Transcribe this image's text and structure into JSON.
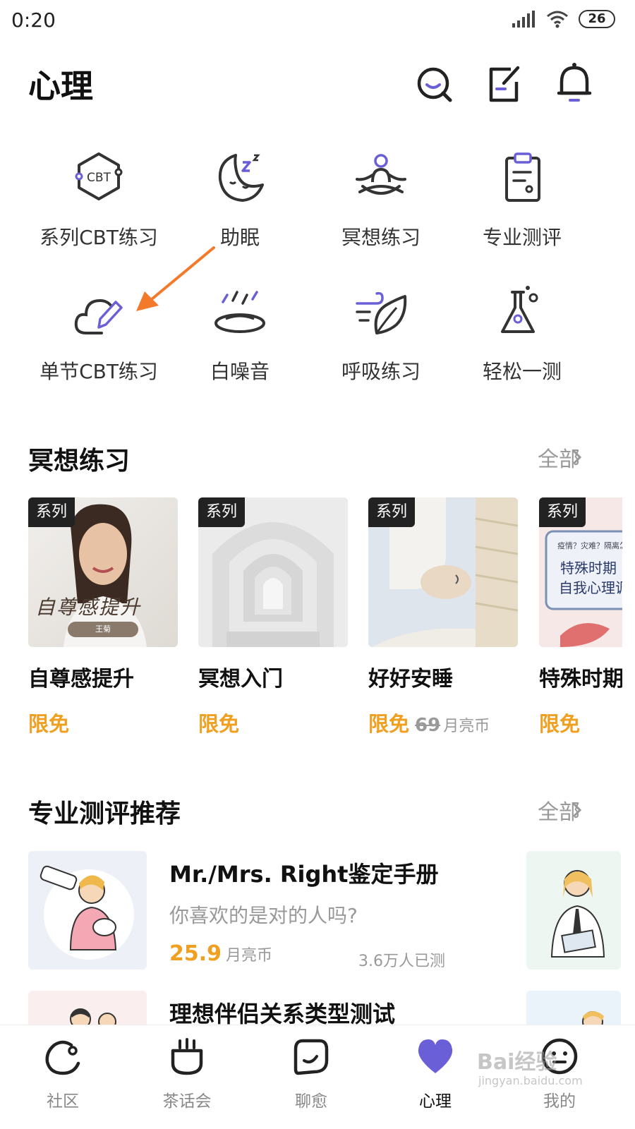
{
  "status_bar": {
    "time": "0:20",
    "battery": "26"
  },
  "header": {
    "title": "心理"
  },
  "feature_grid": [
    {
      "label": "系列CBT练习",
      "icon": "cbt-hexagon-icon"
    },
    {
      "label": "助眠",
      "icon": "moon-sleep-icon"
    },
    {
      "label": "冥想练习",
      "icon": "meditation-icon"
    },
    {
      "label": "专业测评",
      "icon": "clipboard-icon"
    },
    {
      "label": "单节CBT练习",
      "icon": "cloud-pen-icon"
    },
    {
      "label": "白噪音",
      "icon": "rain-icon"
    },
    {
      "label": "呼吸练习",
      "icon": "wind-leaf-icon"
    },
    {
      "label": "轻松一测",
      "icon": "flask-icon"
    }
  ],
  "meditation": {
    "title": "冥想练习",
    "all_label": "全部",
    "cards": [
      {
        "tag": "系列",
        "title": "自尊感提升",
        "price": "限免",
        "thumb_text": "自尊感提升",
        "thumb_sub": "王菊"
      },
      {
        "tag": "系列",
        "title": "冥想入门",
        "price": "限免"
      },
      {
        "tag": "系列",
        "title": "好好安睡",
        "price": "限免",
        "original_price": "69",
        "unit": "月亮币"
      },
      {
        "tag": "系列",
        "title": "特殊时期",
        "price": "限免",
        "thumb_small": "疫情？灾难？隔离怎",
        "thumb_text1": "特殊时期",
        "thumb_text2": "自我心理调"
      }
    ]
  },
  "assessments": {
    "title": "专业测评推荐",
    "all_label": "全部",
    "items": [
      {
        "title": "Mr./Mrs. Right鉴定手册",
        "subtitle": "你喜欢的是对的人吗?",
        "price": "25.9",
        "unit": "月亮币",
        "count": "3.6万人已测"
      },
      {
        "title": "理想伴侣关系类型测试"
      }
    ]
  },
  "tabbar": [
    {
      "label": "社区",
      "active": false
    },
    {
      "label": "茶话会",
      "active": false
    },
    {
      "label": "聊愈",
      "active": false
    },
    {
      "label": "心理",
      "active": true
    },
    {
      "label": "我的",
      "active": false
    }
  ],
  "watermark": {
    "main": "Bai经验",
    "sub": "jingyan.baidu.com"
  },
  "colors": {
    "accent": "#6a5fd6",
    "price": "#f0a020",
    "arrow": "#f27a2a"
  }
}
